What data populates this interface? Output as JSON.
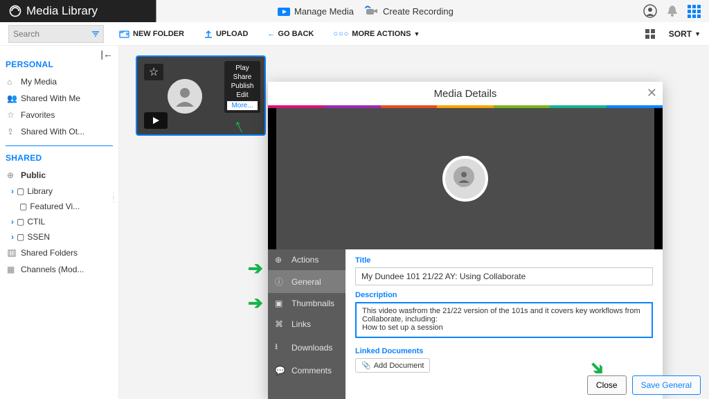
{
  "header": {
    "title": "Media Library",
    "manage_media": "Manage Media",
    "create_recording": "Create Recording"
  },
  "toolbar": {
    "search_placeholder": "Search",
    "new_folder": "NEW FOLDER",
    "upload": "UPLOAD",
    "go_back": "GO BACK",
    "more_actions": "MORE ACTIONS",
    "sort": "SORT"
  },
  "sidebar": {
    "personal": "PERSONAL",
    "shared": "SHARED",
    "items": [
      "My Media",
      "Shared With Me",
      "Favorites",
      "Shared With Ot..."
    ],
    "public": "Public",
    "tree": [
      "Library",
      "Featured Vi...",
      "CTIL",
      "SSEN"
    ],
    "shared_folders": "Shared Folders",
    "channels": "Channels (Mod..."
  },
  "card_opts": [
    "Play",
    "Share",
    "Publish",
    "Edit",
    "More..."
  ],
  "modal": {
    "title": "Media Details",
    "tabs": [
      "Actions",
      "General",
      "Thumbnails",
      "Links",
      "Downloads",
      "Comments"
    ],
    "labels": {
      "title": "Title",
      "description": "Description",
      "linked": "Linked Documents"
    },
    "add_doc": "Add Document",
    "close": "Close",
    "save": "Save General",
    "form": {
      "title_val": "My Dundee 101 21/22 AY: Using Collaborate",
      "desc_val": "This video wasfrom the 21/22 version of the 101s and it covers key workflows from Collaborate, including:\nHow to set up a session"
    }
  },
  "rainbow_colors": [
    "#d9127a",
    "#9c2bb3",
    "#e94e1b",
    "#f7a400",
    "#7ab51d",
    "#17b299",
    "#0a84ff"
  ]
}
